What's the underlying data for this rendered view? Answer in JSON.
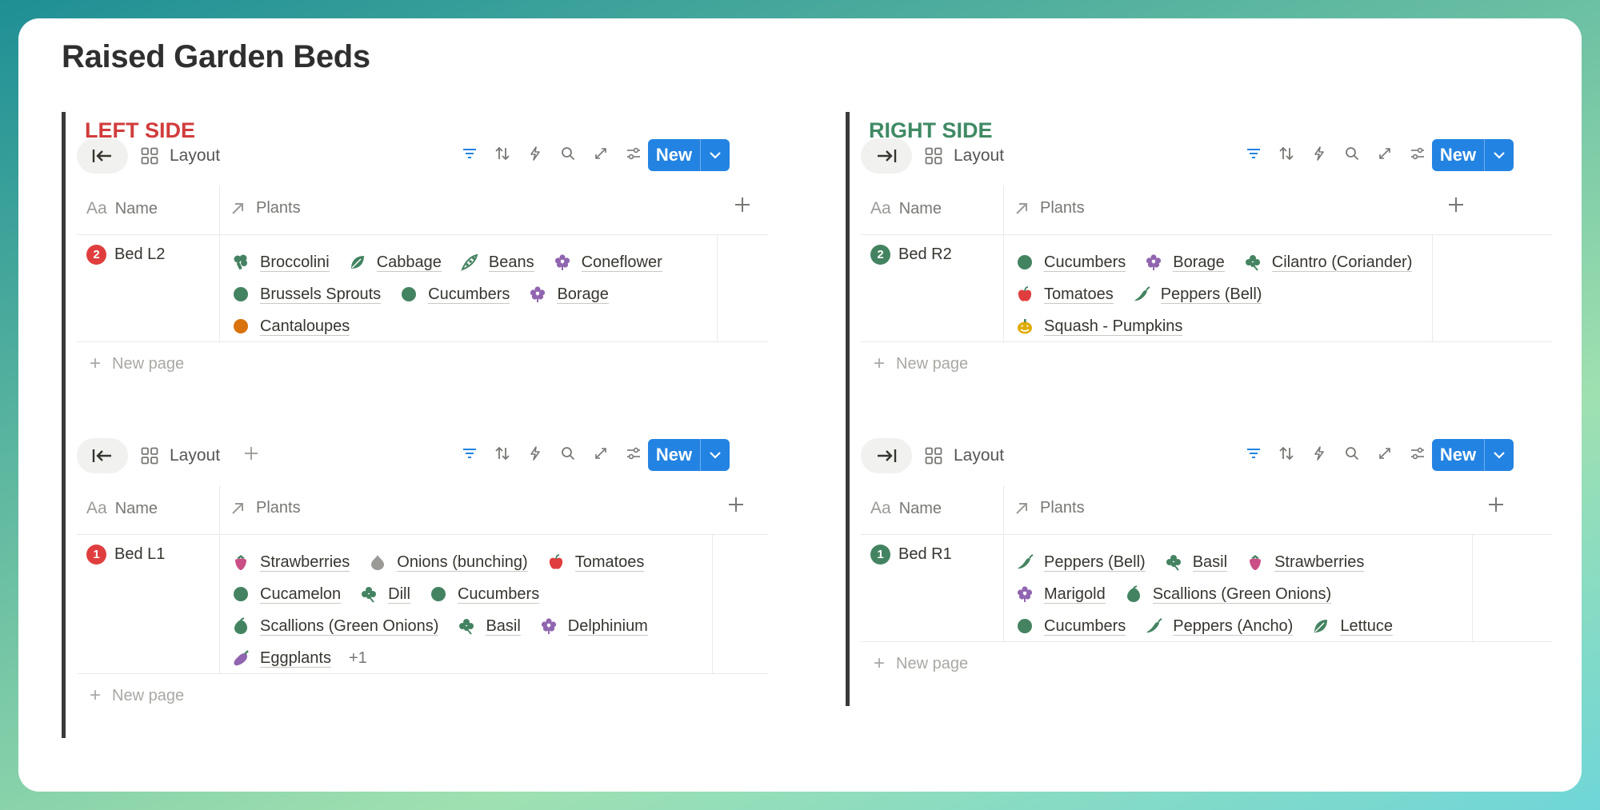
{
  "page": {
    "title": "Raised Garden Beds"
  },
  "left": {
    "heading": "LEFT SIDE",
    "dbs": [
      {
        "toolbar": {
          "layout": "Layout",
          "new": "New"
        },
        "headers": {
          "name": "Name",
          "plants": "Plants"
        },
        "row": {
          "badge": "2",
          "name": "Bed L2",
          "lines": [
            [
              {
                "icon": "broccoli-icon",
                "label": "Broccolini"
              },
              {
                "icon": "leaf-icon",
                "label": "Cabbage"
              },
              {
                "icon": "pea-pod-icon",
                "label": "Beans"
              },
              {
                "icon": "flower-icon",
                "label": "Coneflower"
              }
            ],
            [
              {
                "icon": "green-circle-icon",
                "label": "Brussels Sprouts"
              },
              {
                "icon": "green-circle-icon",
                "label": "Cucumbers"
              },
              {
                "icon": "flower-icon",
                "label": "Borage"
              }
            ],
            [
              {
                "icon": "orange-circle-icon",
                "label": "Cantaloupes"
              }
            ]
          ]
        },
        "new_page": "New page"
      },
      {
        "toolbar": {
          "layout": "Layout",
          "new": "New"
        },
        "headers": {
          "name": "Name",
          "plants": "Plants"
        },
        "row": {
          "badge": "1",
          "name": "Bed L1",
          "lines": [
            [
              {
                "icon": "strawberry-icon",
                "label": "Strawberries"
              },
              {
                "icon": "onion-icon",
                "label": "Onions (bunching)"
              },
              {
                "icon": "apple-icon",
                "label": "Tomatoes"
              }
            ],
            [
              {
                "icon": "green-circle-icon",
                "label": "Cucamelon"
              },
              {
                "icon": "clover-icon",
                "label": "Dill"
              },
              {
                "icon": "green-circle-icon",
                "label": "Cucumbers"
              }
            ],
            [
              {
                "icon": "bulb-icon",
                "label": "Scallions (Green Onions)"
              },
              {
                "icon": "clover-icon",
                "label": "Basil"
              },
              {
                "icon": "flower-icon",
                "label": "Delphinium"
              }
            ],
            [
              {
                "icon": "eggplant-icon",
                "label": "Eggplants"
              }
            ]
          ],
          "more": "+1"
        },
        "new_page": "New page"
      }
    ]
  },
  "right": {
    "heading": "RIGHT SIDE",
    "dbs": [
      {
        "toolbar": {
          "layout": "Layout",
          "new": "New"
        },
        "headers": {
          "name": "Name",
          "plants": "Plants"
        },
        "row": {
          "badge": "2",
          "name": "Bed R2",
          "lines": [
            [
              {
                "icon": "green-circle-icon",
                "label": "Cucumbers"
              },
              {
                "icon": "flower-icon",
                "label": "Borage"
              },
              {
                "icon": "clover-icon",
                "label": "Cilantro (Coriander)"
              }
            ],
            [
              {
                "icon": "apple-icon",
                "label": "Tomatoes"
              },
              {
                "icon": "pepper-icon",
                "label": "Peppers (Bell)"
              }
            ],
            [
              {
                "icon": "pumpkin-icon",
                "label": "Squash - Pumpkins"
              }
            ]
          ]
        },
        "new_page": "New page"
      },
      {
        "toolbar": {
          "layout": "Layout",
          "new": "New"
        },
        "headers": {
          "name": "Name",
          "plants": "Plants"
        },
        "row": {
          "badge": "1",
          "name": "Bed R1",
          "lines": [
            [
              {
                "icon": "pepper-icon",
                "label": "Peppers (Bell)"
              },
              {
                "icon": "clover-icon",
                "label": "Basil"
              },
              {
                "icon": "strawberry-icon",
                "label": "Strawberries"
              }
            ],
            [
              {
                "icon": "flower-icon",
                "label": "Marigold"
              },
              {
                "icon": "bulb-icon",
                "label": "Scallions (Green Onions)"
              }
            ],
            [
              {
                "icon": "green-circle-icon",
                "label": "Cucumbers"
              },
              {
                "icon": "pepper-icon",
                "label": "Peppers (Ancho)"
              },
              {
                "icon": "leaf-icon",
                "label": "Lettuce"
              }
            ]
          ]
        },
        "new_page": "New page"
      }
    ]
  },
  "colors": {
    "accent": "#2383e2",
    "left_heading": "#d13c3c",
    "right_heading": "#3f8a64",
    "badge_red": "#e03e3e",
    "badge_green": "#448361",
    "plant_green": "#448361",
    "plant_purple": "#9065b0",
    "plant_orange": "#d9730d"
  }
}
